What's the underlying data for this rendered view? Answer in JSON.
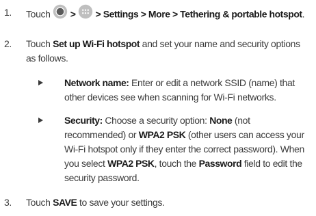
{
  "steps": [
    {
      "number": "1.",
      "touch": "Touch",
      "sep1": ">",
      "sep2": "> Settings > More > Tethering & portable hotspot",
      "end": "."
    },
    {
      "number": "2.",
      "pre": "Touch ",
      "bold1": "Set up Wi-Fi hotspot",
      "post": " and set your name and security options as follows."
    },
    {
      "number": "3.",
      "pre": "Touch ",
      "bold1": "SAVE",
      "post": " to save your settings."
    }
  ],
  "bullets": [
    {
      "label": "Network name:",
      "text": " Enter or edit a network SSID (name) that other devices see when scanning for Wi-Fi networks."
    },
    {
      "label": "Security:",
      "t1": " Choose a security option: ",
      "b1": "None",
      "t2": " (not recommended) or ",
      "b2": "WPA2 PSK",
      "t3": " (other users can access your Wi-Fi hotspot only if they enter the correct password). When you select ",
      "b3": "WPA2 PSK",
      "t4": ", touch the ",
      "b4": "Password",
      "t5": " field to edit the security password."
    }
  ],
  "icons": {
    "home": "home-circle-icon",
    "apps": "apps-grid-icon",
    "bullet": "triangle-bullet-icon"
  },
  "colors": {
    "text": "#3a3a3a",
    "bold": "#1a1a1a",
    "icon": "#b0b0b0"
  }
}
